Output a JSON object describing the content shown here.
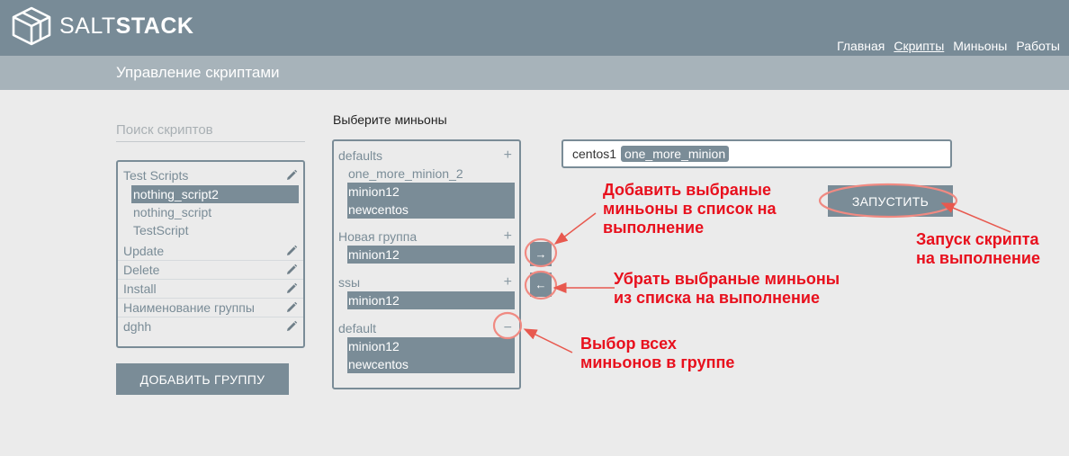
{
  "brand": {
    "name_light": "SALT",
    "name_bold": "STACK"
  },
  "nav": {
    "items": [
      {
        "label": "Главная"
      },
      {
        "label": "Скрипты"
      },
      {
        "label": "Миньоны"
      },
      {
        "label": "Работы"
      }
    ]
  },
  "page": {
    "title": "Управление скриптами"
  },
  "scripts": {
    "search_placeholder": "Поиск скриптов",
    "groups": [
      {
        "label": "Test Scripts",
        "items": [
          "nothing_script2",
          "nothing_script",
          "TestScript"
        ],
        "selected": "nothing_script2"
      },
      {
        "label": "Update"
      },
      {
        "label": "Delete"
      },
      {
        "label": "Install"
      },
      {
        "label": "Наименование группы"
      },
      {
        "label": "dghh"
      }
    ],
    "add_group_label": "ДОБАВИТЬ ГРУППУ"
  },
  "minions": {
    "section_label": "Выберите миньоны",
    "groups": [
      {
        "label": "defaults",
        "toggle": "+",
        "items": [
          "one_more_minion_2",
          "minion12",
          "newcentos"
        ]
      },
      {
        "label": "Новая группа",
        "toggle": "+",
        "items": [
          "minion12"
        ]
      },
      {
        "label": "ssы",
        "toggle": "+",
        "items": [
          "minion12"
        ]
      },
      {
        "label": "default",
        "toggle": "−",
        "items": [
          "minion12",
          "newcentos"
        ]
      }
    ],
    "add_arrow": "→",
    "remove_arrow": "←"
  },
  "target": {
    "host": "centos1",
    "chip": "one_more_minion"
  },
  "run_label": "ЗАПУСТИТЬ",
  "annotations": {
    "add_selected": [
      "Добавить выбраные",
      "миньоны в список на",
      "выполнение"
    ],
    "remove_selected": [
      "Убрать выбраные миньоны",
      "из списка на выполнение"
    ],
    "select_all": [
      "Выбор всех",
      "миньонов в группе"
    ],
    "run_script": [
      "Запуск скрипта",
      "на выполнение"
    ]
  },
  "colors": {
    "header": "#788b97",
    "subheader": "#a7b3ba",
    "accent": "#7a8c97",
    "annotation": "#e8101d",
    "background": "#ebebeb"
  }
}
